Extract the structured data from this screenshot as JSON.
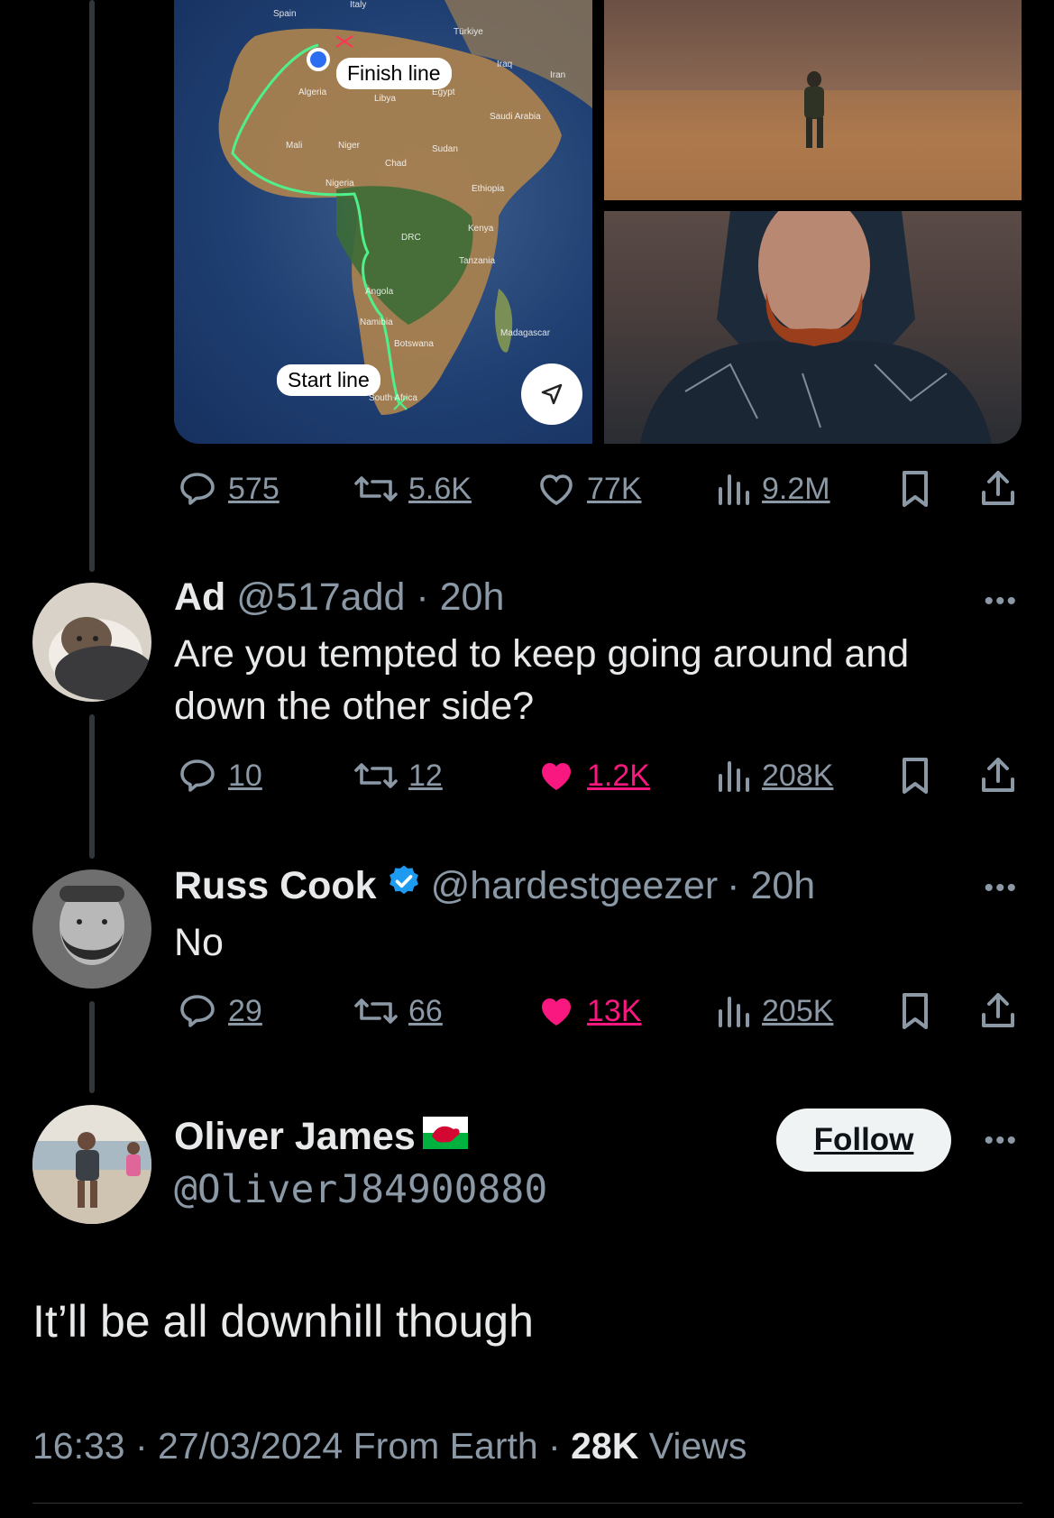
{
  "media": {
    "map": {
      "finish_label": "Finish line",
      "start_label": "Start line",
      "countries": [
        "Spain",
        "Italy",
        "Türkiye",
        "Iraq",
        "Iran",
        "Algeria",
        "Libya",
        "Egypt",
        "Saudi Arabia",
        "Mali",
        "Niger",
        "Chad",
        "Sudan",
        "Nigeria",
        "Ethiopia",
        "Kenya",
        "DRC",
        "Tanzania",
        "Angola",
        "Namibia",
        "Botswana",
        "Madagascar",
        "South Africa"
      ]
    }
  },
  "original_tweet": {
    "replies": "575",
    "retweets": "5.6K",
    "likes": "77K",
    "views": "9.2M"
  },
  "reply1": {
    "name": "Ad",
    "handle": "@517add",
    "time": "· 20h",
    "text": "Are you tempted to keep going around and down the other side?",
    "replies": "10",
    "retweets": "12",
    "likes": "1.2K",
    "views": "208K"
  },
  "reply2": {
    "name": "Russ Cook",
    "handle": "@hardestgeezer",
    "time": "· 20h",
    "text": "No",
    "replies": "29",
    "retweets": "66",
    "likes": "13K",
    "views": "205K"
  },
  "main_tweet": {
    "name": "Oliver James",
    "handle": "@OliverJ84900880",
    "follow_label": "Follow",
    "text": "It’ll be all downhill though",
    "timestamp": "16:33 · 27/03/2024 From Earth ·",
    "views_count": "28K",
    "views_label": "Views"
  },
  "colors": {
    "background": "#000000",
    "text": "#e7e9ea",
    "muted": "#8b98a5",
    "like_pink": "#f91880",
    "verified_blue": "#1d9bf0"
  }
}
